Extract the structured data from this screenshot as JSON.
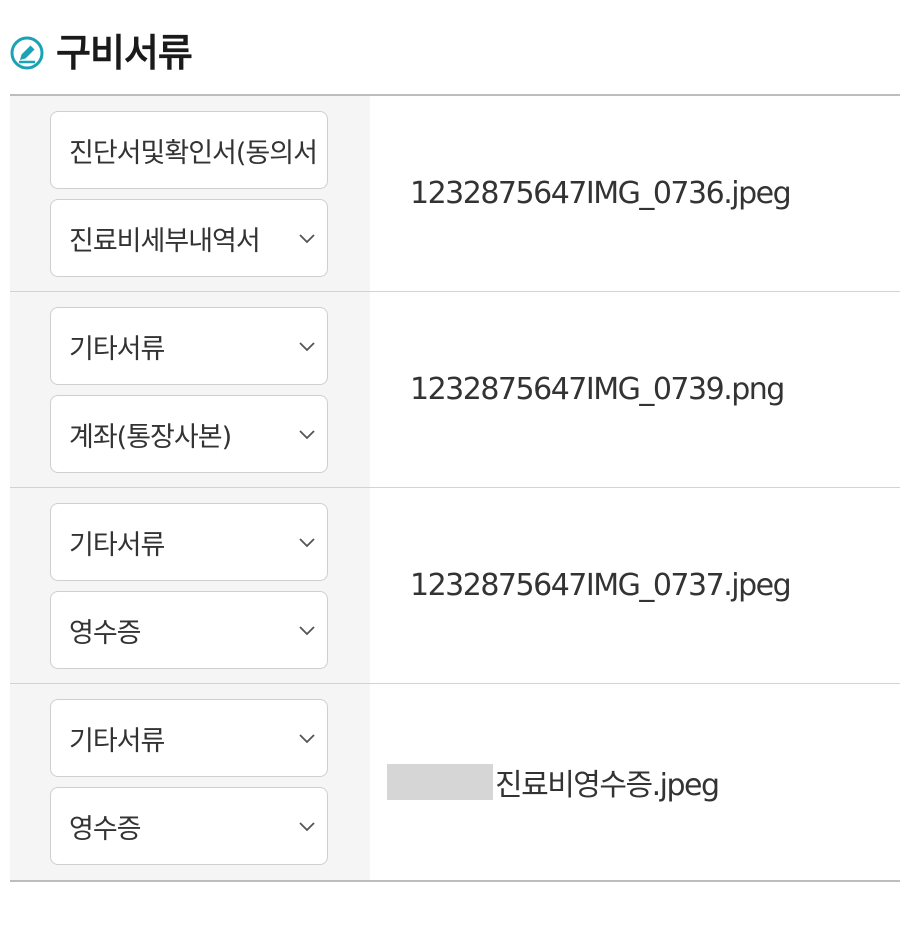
{
  "header": {
    "title": "구비서류",
    "icon": "edit-circle-icon",
    "accent_color": "#1aa3b5"
  },
  "documents": [
    {
      "selects": [
        {
          "value": "진단서및확인서(동의서"
        },
        {
          "value": "진료비세부내역서"
        }
      ],
      "file_name": "1232875647IMG_0736.jpeg"
    },
    {
      "selects": [
        {
          "value": "기타서류"
        },
        {
          "value": "계좌(통장사본)"
        }
      ],
      "file_name": "1232875647IMG_0739.png"
    },
    {
      "selects": [
        {
          "value": "기타서류"
        },
        {
          "value": "영수증"
        }
      ],
      "file_name": "1232875647IMG_0737.jpeg"
    },
    {
      "selects": [
        {
          "value": "기타서류"
        },
        {
          "value": "영수증"
        }
      ],
      "file_name": "진료비영수증.jpeg"
    }
  ]
}
